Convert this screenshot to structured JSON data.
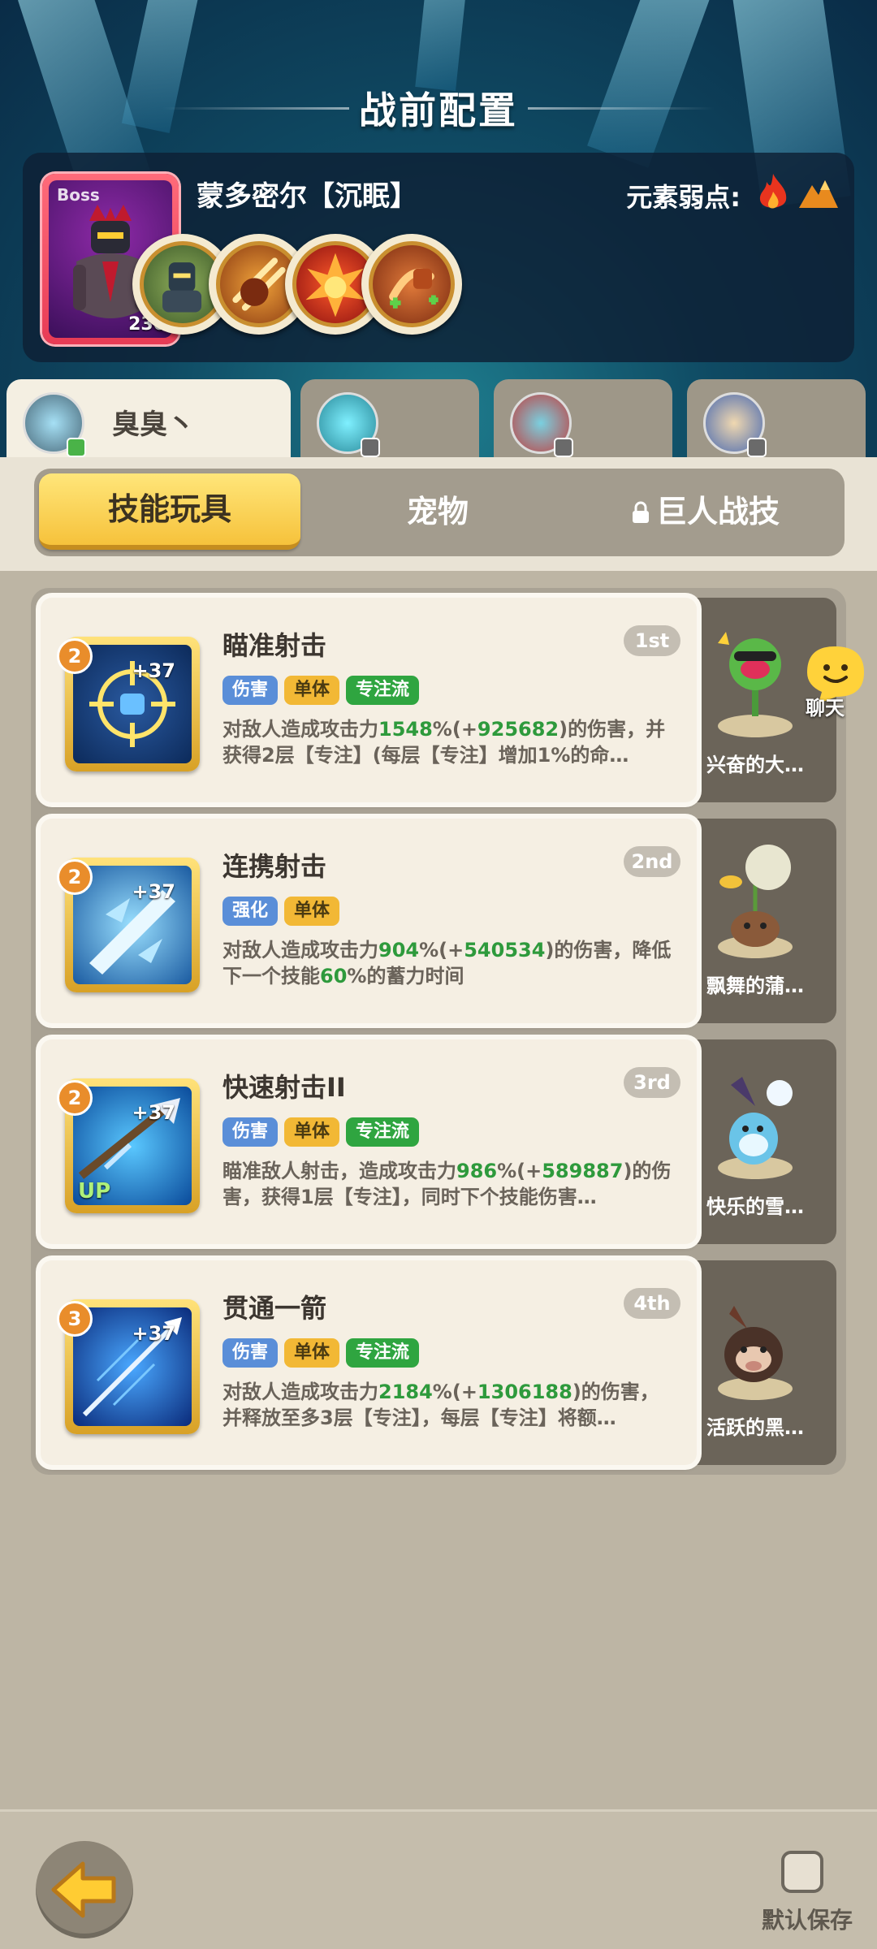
{
  "header": {
    "title": "战前配置"
  },
  "boss": {
    "tag": "Boss",
    "level": "230",
    "name": "蒙多密尔【沉眠】",
    "weakness_label": "元素弱点:",
    "weakness_icons": [
      "fire-icon",
      "mountain-icon"
    ],
    "skill_icons": [
      "armored-knight-icon",
      "claw-slash-icon",
      "fire-burst-icon",
      "healing-fist-icon"
    ]
  },
  "characters": [
    {
      "name": "臭臭丶",
      "active": true
    },
    {
      "name": "",
      "active": false
    },
    {
      "name": "",
      "active": false
    },
    {
      "name": "",
      "active": false
    }
  ],
  "tabs": [
    {
      "label": "技能玩具",
      "active": true
    },
    {
      "label": "宠物",
      "active": false
    },
    {
      "label": "巨人战技",
      "active": false,
      "locked": true
    }
  ],
  "skills": [
    {
      "name": "瞄准射击",
      "rank": "1st",
      "level": "2",
      "plus": "+37",
      "up": "",
      "tags": [
        "伤害",
        "单体",
        "专注流"
      ],
      "desc": [
        "对敌人造成攻击力",
        "1548",
        "%(+",
        "925682",
        ")的伤害，并获得2层【专注】(每层【专注】增加1%的命…"
      ],
      "pet": "兴奋的大…"
    },
    {
      "name": "连携射击",
      "rank": "2nd",
      "level": "2",
      "plus": "+37",
      "up": "",
      "tags": [
        "强化",
        "单体"
      ],
      "desc": [
        "对敌人造成攻击力",
        "904",
        "%(+",
        "540534",
        ")的伤害，降低下一个技能",
        "60",
        "%的蓄力时间"
      ],
      "pet": "飘舞的蒲…"
    },
    {
      "name": "快速射击II",
      "rank": "3rd",
      "level": "2",
      "plus": "+37",
      "up": "UP",
      "tags": [
        "伤害",
        "单体",
        "专注流"
      ],
      "desc": [
        "瞄准敌人射击，造成攻击力",
        "986",
        "%(+",
        "589887",
        ")的伤害，获得1层【专注】，同时下个技能伤害…"
      ],
      "pet": "快乐的雪…"
    },
    {
      "name": "贯通一箭",
      "rank": "4th",
      "level": "3",
      "plus": "+37",
      "up": "",
      "tags": [
        "伤害",
        "单体",
        "专注流"
      ],
      "desc": [
        "对敌人造成攻击力",
        "2184",
        "%(+",
        "1306188",
        ")的伤害，并释放至多3层【专注】，每层【专注】将额…"
      ],
      "pet": "活跃的黑…"
    }
  ],
  "chat": {
    "label": "聊天"
  },
  "footer": {
    "save_label": "默认保存"
  },
  "colors": {
    "accent_yellow": "#f6c23b",
    "highlight_green": "#2e9a3c",
    "tag_blue": "#5a8ed8",
    "tag_green": "#2fa540"
  }
}
